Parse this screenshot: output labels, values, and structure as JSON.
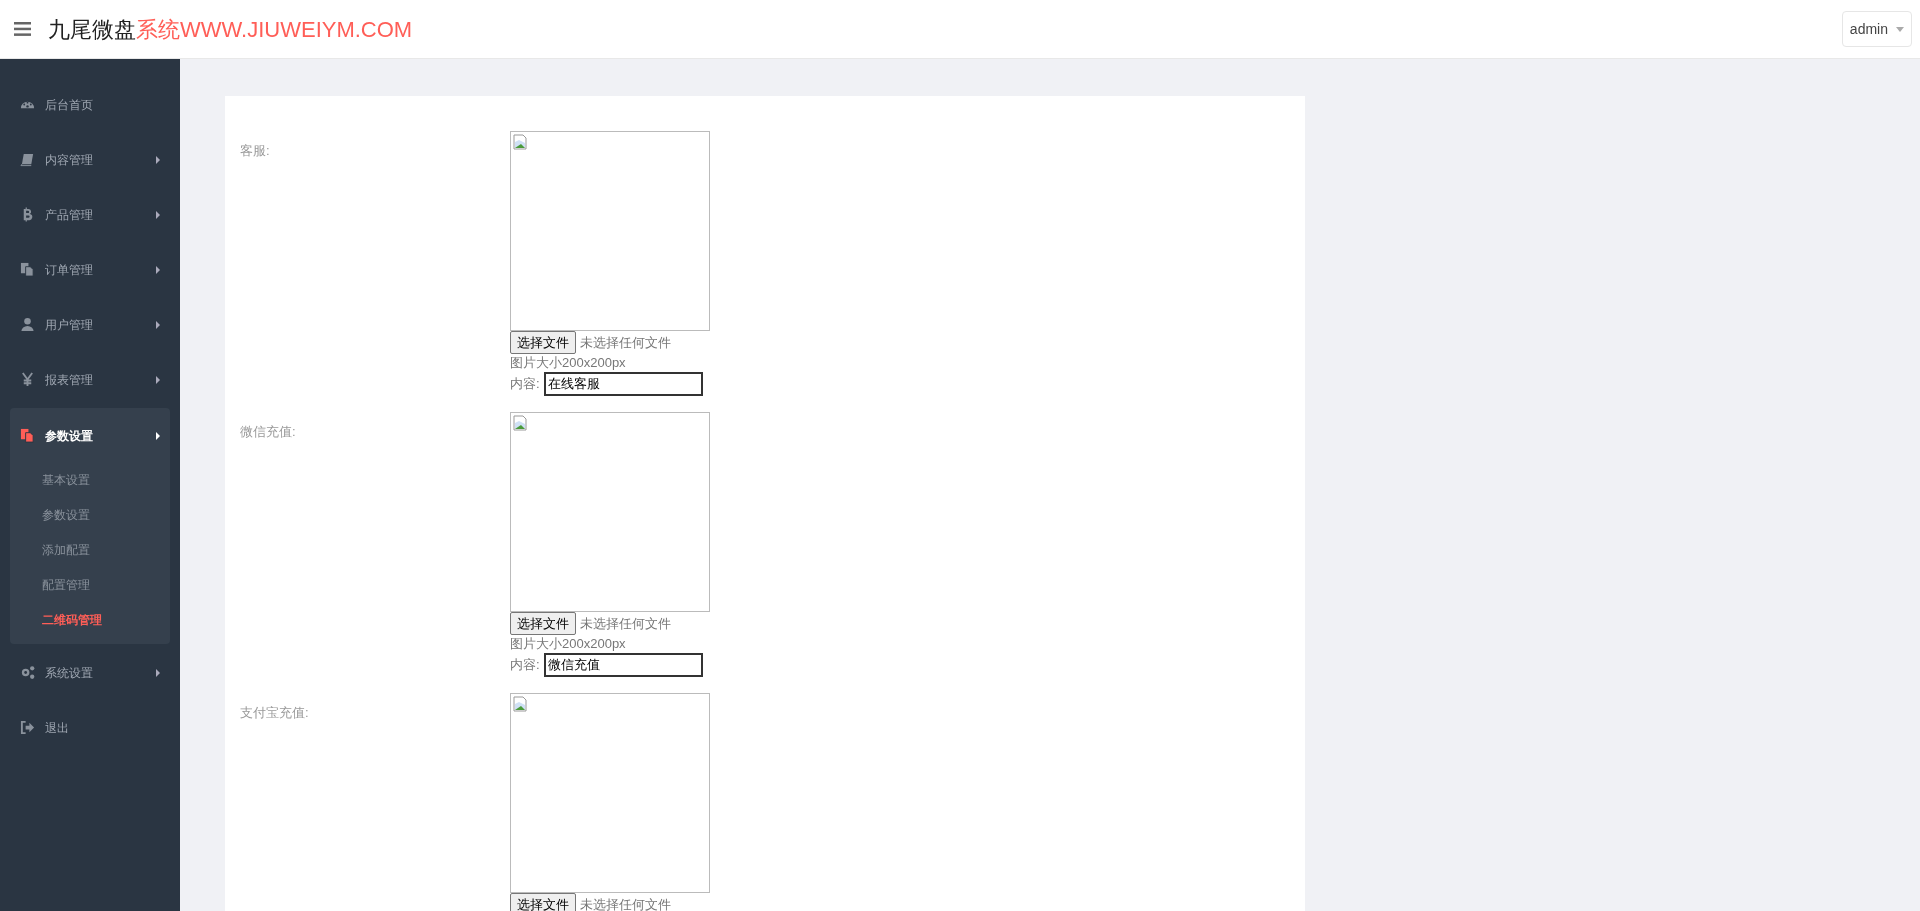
{
  "header": {
    "brand": "九尾微盘",
    "brand_accent": "系统WWW.JIUWEIYM.COM",
    "user": "admin"
  },
  "sidebar": {
    "items": [
      {
        "label": "后台首页",
        "expandable": false,
        "selected": false
      },
      {
        "label": "内容管理",
        "expandable": true,
        "selected": false
      },
      {
        "label": "产品管理",
        "expandable": true,
        "selected": false
      },
      {
        "label": "订单管理",
        "expandable": true,
        "selected": false
      },
      {
        "label": "用户管理",
        "expandable": true,
        "selected": false
      },
      {
        "label": "报表管理",
        "expandable": true,
        "selected": false
      },
      {
        "label": "参数设置",
        "expandable": true,
        "selected": true,
        "expanded": true,
        "children": [
          {
            "label": "基本设置",
            "selected": false
          },
          {
            "label": "参数设置",
            "selected": false
          },
          {
            "label": "添加配置",
            "selected": false
          },
          {
            "label": "配置管理",
            "selected": false
          },
          {
            "label": "二维码管理",
            "selected": true
          }
        ]
      },
      {
        "label": "系统设置",
        "expandable": true,
        "selected": false
      },
      {
        "label": "退出",
        "expandable": false,
        "selected": false
      }
    ]
  },
  "form": {
    "rows": [
      {
        "label": "客服:",
        "file_button": "选择文件",
        "file_status": "未选择任何文件",
        "hint": "图片大小200x200px",
        "content_label": "内容:",
        "content_value": "在线客服"
      },
      {
        "label": "微信充值:",
        "file_button": "选择文件",
        "file_status": "未选择任何文件",
        "hint": "图片大小200x200px",
        "content_label": "内容:",
        "content_value": "微信充值"
      },
      {
        "label": "支付宝充值:",
        "file_button": "选择文件",
        "file_status": "未选择任何文件"
      }
    ]
  }
}
